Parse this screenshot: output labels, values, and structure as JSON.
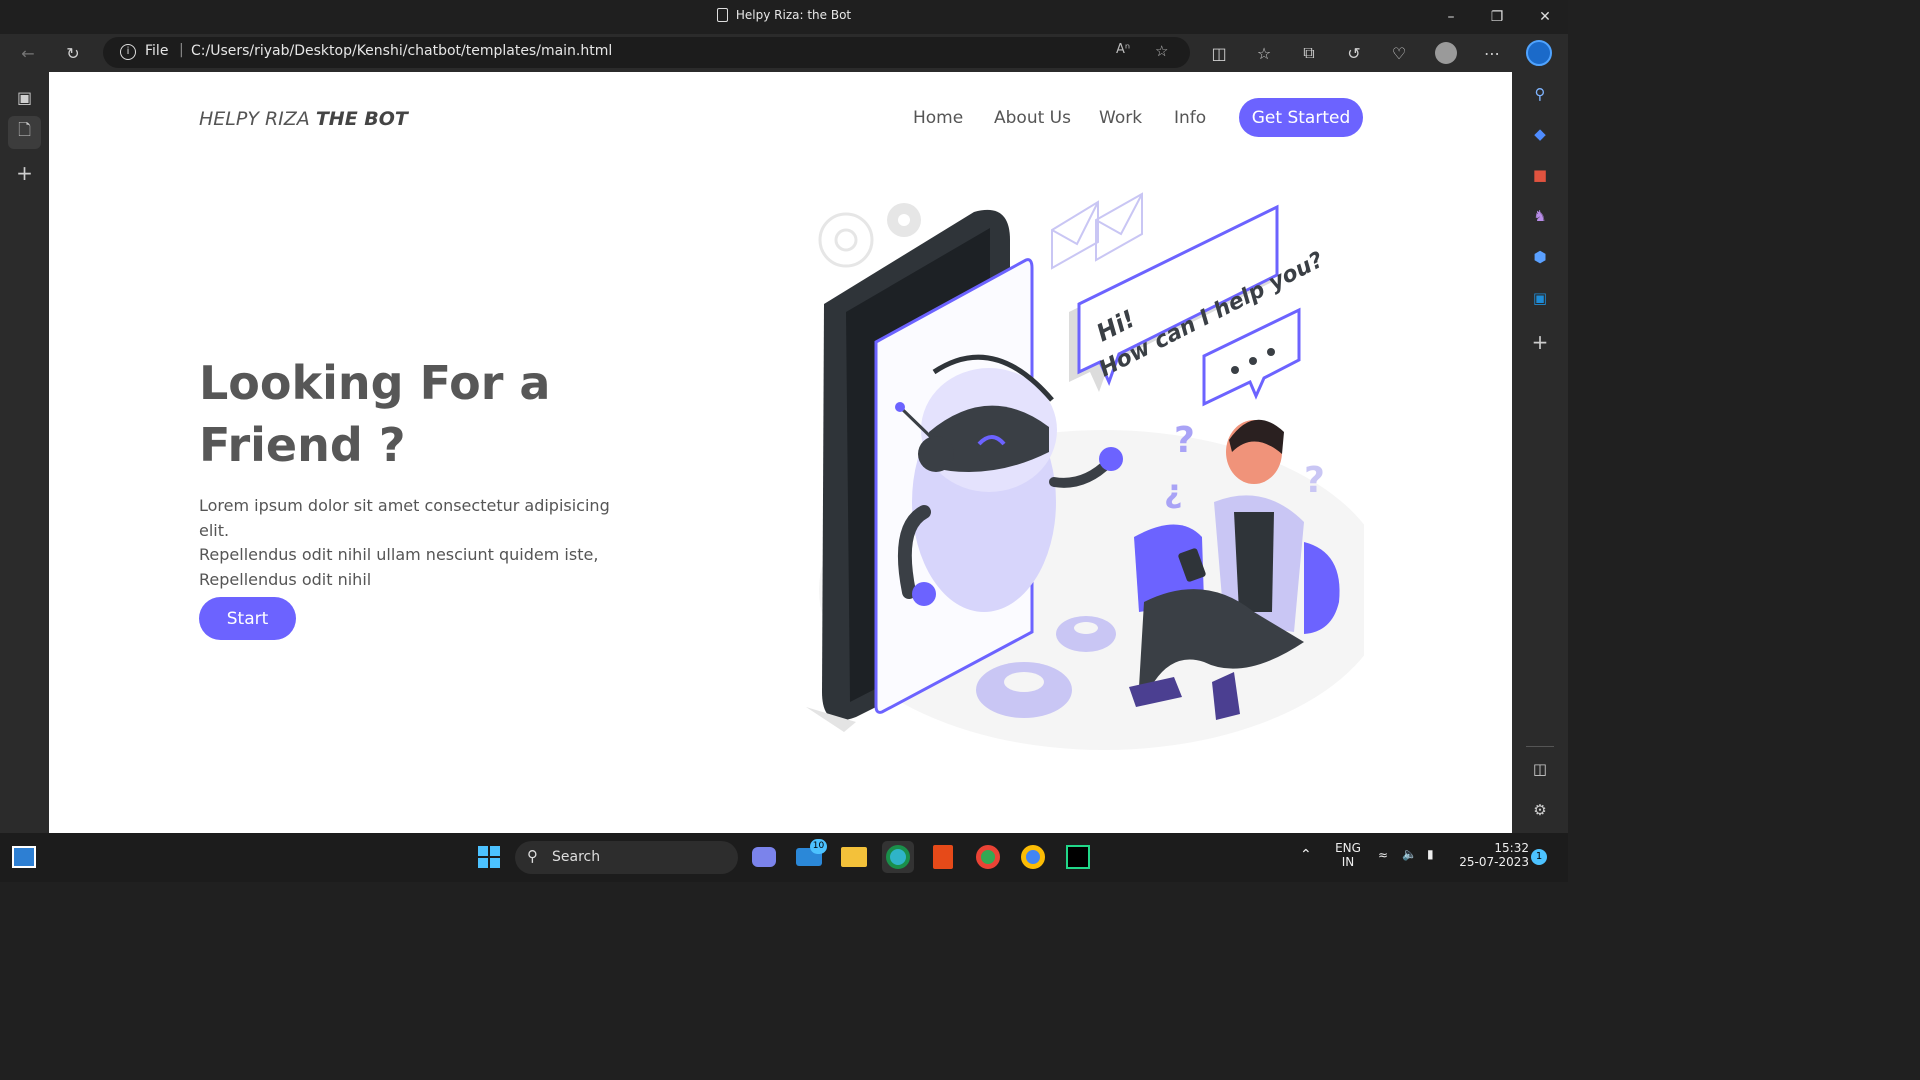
{
  "browser": {
    "window_title": "Helpy Riza: the Bot",
    "address": {
      "scheme": "File",
      "url": "C:/Users/riyab/Desktop/Kenshi/chatbot/templates/main.html"
    }
  },
  "site": {
    "logo": {
      "light": "HELPY RIZA ",
      "bold": "THE BOT"
    },
    "nav": [
      "Home",
      "About Us",
      "Work",
      "Info"
    ],
    "cta": "Get Started",
    "hero": {
      "title_line1": "Looking For a",
      "title_line2": "Friend ?",
      "text_line1": "Lorem ipsum dolor sit amet consectetur adipisicing elit.",
      "text_line2": "Repellendus odit nihil ullam nesciunt quidem iste,",
      "text_line3": "Repellendus odit nihil",
      "button": "Start"
    },
    "illustration": {
      "bubble_line1": "Hi!",
      "bubble_line2": "How can I help you?"
    }
  },
  "taskbar": {
    "search_label": "Search",
    "mail_badge": "10",
    "lang_line1": "ENG",
    "lang_line2": "IN",
    "time": "15:32",
    "date": "25-07-2023",
    "notification_count": "1"
  },
  "colors": {
    "accent": "#6c63ff",
    "text": "#555555",
    "chrome": "#2b2b2b"
  }
}
